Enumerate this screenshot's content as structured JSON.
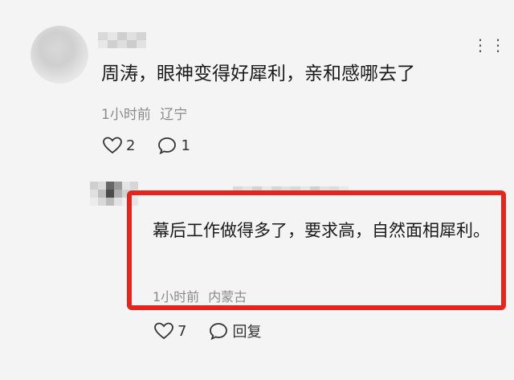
{
  "comment": {
    "text": "周涛，眼神变得好犀利，亲和感哪去了",
    "time": "1小时前",
    "location": "辽宁",
    "likes": "2",
    "replies": "1",
    "more_icon": "ellipsis-icon"
  },
  "reply": {
    "text": "幕后工作做得多了，要求高，自然面相犀利。",
    "time": "1小时前",
    "location": "内蒙古",
    "likes": "7",
    "reply_label": "回复"
  },
  "colors": {
    "highlight": "#e4251d",
    "meta_text": "#8a8a8a",
    "background": "#f4f4f4"
  }
}
